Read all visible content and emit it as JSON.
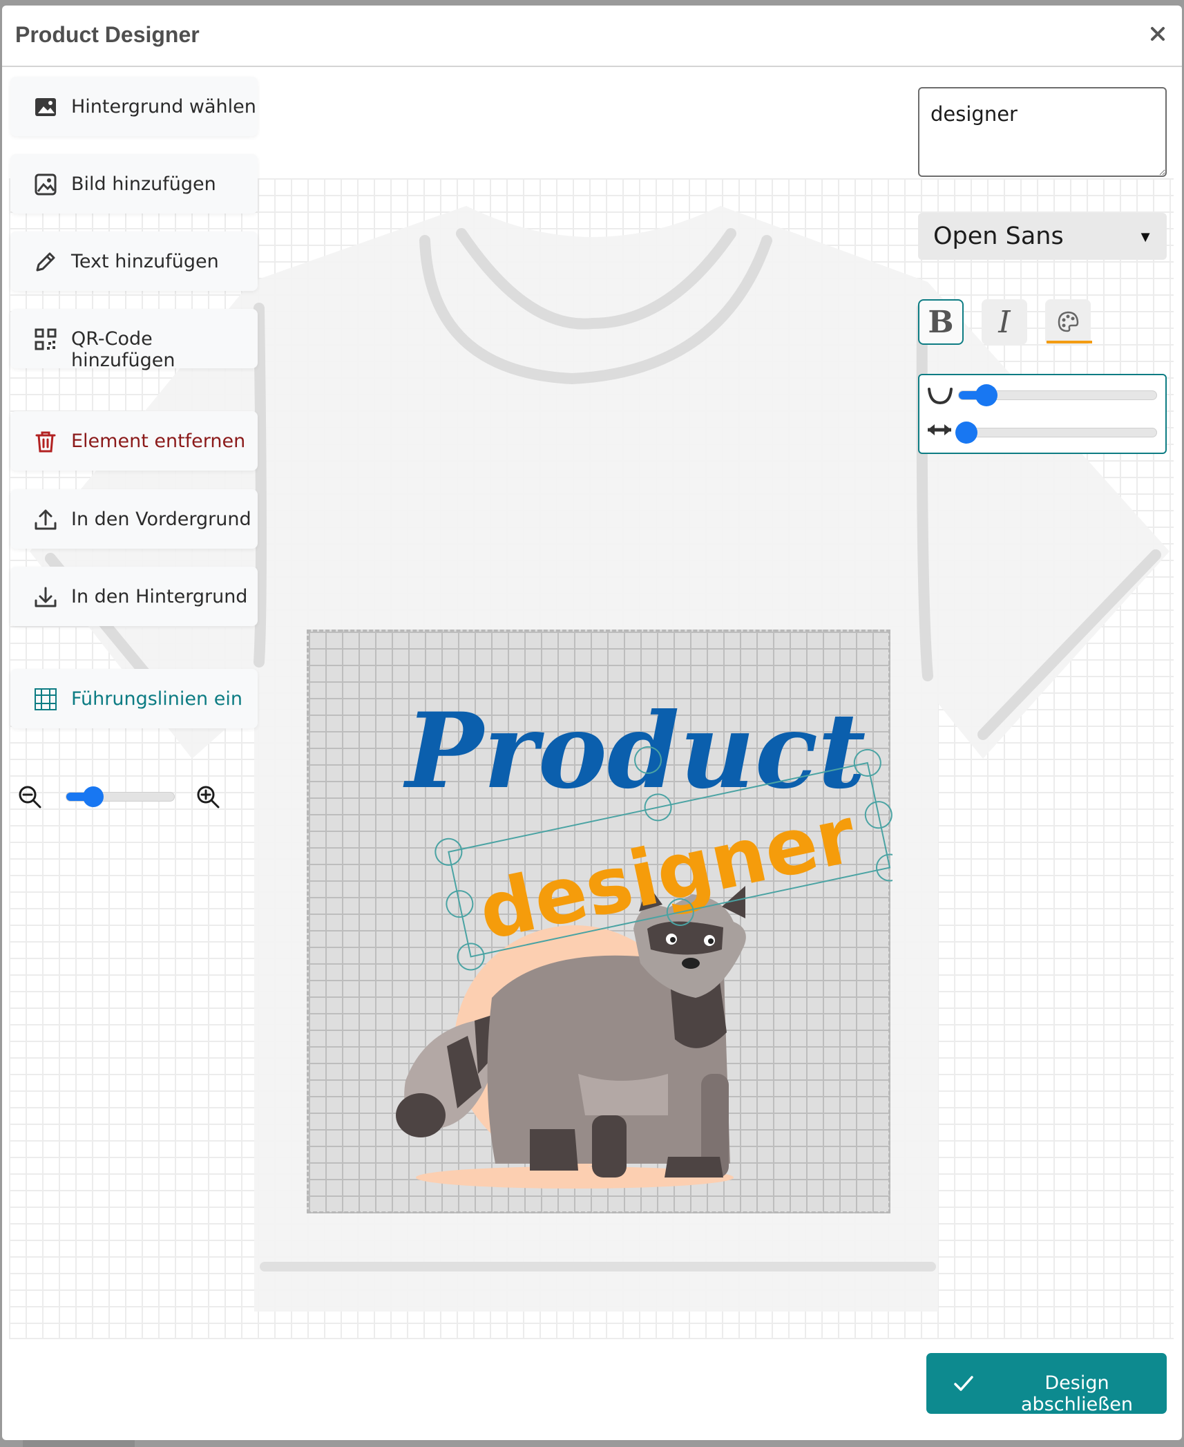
{
  "dialog": {
    "title": "Product Designer",
    "close_label": "×"
  },
  "tools": {
    "background": "Hintergrund wählen",
    "add_image": "Bild hinzufügen",
    "add_text": "Text hinzufügen",
    "add_qr": "QR-Code hinzufügen",
    "remove": "Element entfernen",
    "bring_front": "In den Vordergrund",
    "send_back": "In den Hintergrund",
    "guides": "Führungslinien ein"
  },
  "zoom": {
    "level": 0.25
  },
  "text_panel": {
    "text_value": "designer",
    "font": "Open Sans",
    "font_caret": "▼",
    "bold_label": "B",
    "italic_label": "I",
    "curve_level": 0.14,
    "spacing_level": 0.04
  },
  "canvas": {
    "logo_word": "Product",
    "selected_word": "designer"
  },
  "colors": {
    "accent": "#0d8a8f",
    "logo_blue": "#0b5fad",
    "text_orange": "#f59c0b",
    "slider_blue": "#1877f2",
    "danger": "#8b1a1a"
  },
  "footer": {
    "finish_label": "Design abschließen"
  }
}
